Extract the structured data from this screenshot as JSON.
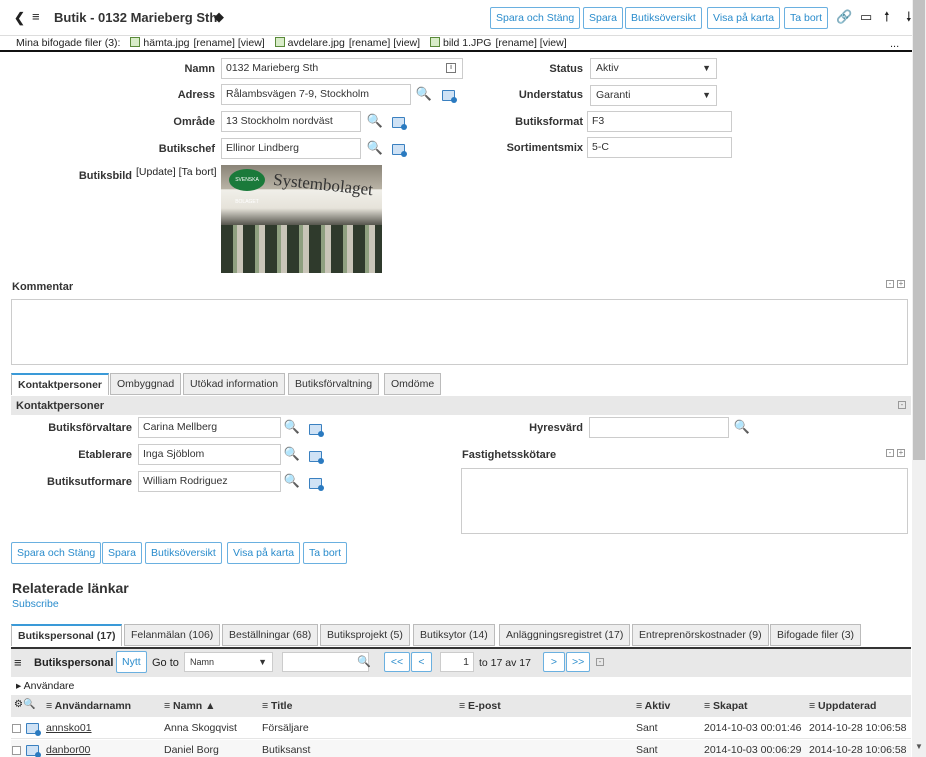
{
  "header": {
    "title": "Butik - 0132 Marieberg Sth",
    "buttons": [
      "Spara och Stäng",
      "Spara",
      "Butiksöversikt",
      "Visa på karta",
      "Ta bort"
    ]
  },
  "files": {
    "label": "Mina bifogade filer (3):",
    "items": [
      {
        "name": "hämta.jpg",
        "actions": "[rename] [view]"
      },
      {
        "name": "avdelare.jpg",
        "actions": "[rename] [view]"
      },
      {
        "name": "bild 1.JPG",
        "actions": "[rename] [view]"
      }
    ],
    "more": "..."
  },
  "form": {
    "namn_label": "Namn",
    "namn": "0132 Marieberg Sth",
    "adress_label": "Adress",
    "adress": "Rålambsvägen 7-9, Stockholm",
    "omrade_label": "Område",
    "omrade": "13 Stockholm nordväst",
    "butikschef_label": "Butikschef",
    "butikschef": "Ellinor Lindberg",
    "butiksbild_label": "Butiksbild",
    "butiksbild_actions": "[Update] [Ta bort]",
    "image_text": "Systembolaget",
    "image_badge": "SVENSKA BOLAGET",
    "status_label": "Status",
    "status": "Aktiv",
    "understatus_label": "Understatus",
    "understatus": "Garanti",
    "butiksformat_label": "Butiksformat",
    "butiksformat": "F3",
    "sortimentsmix_label": "Sortimentsmix",
    "sortimentsmix": "5-C",
    "kommentar_label": "Kommentar"
  },
  "tabs1": [
    "Kontaktpersoner",
    "Ombyggnad",
    "Utökad information",
    "Butiksförvaltning",
    "Omdöme"
  ],
  "contacts": {
    "section": "Kontaktpersoner",
    "forvaltare_label": "Butiksförvaltare",
    "forvaltare": "Carina Mellberg",
    "etablerare_label": "Etablerare",
    "etablerare": "Inga Sjöblom",
    "utformare_label": "Butiksutformare",
    "utformare": "William Rodriguez",
    "hyresvard_label": "Hyresvärd",
    "hyresvard": "",
    "fastighet_label": "Fastighetsskötare"
  },
  "bottom_buttons": [
    "Spara och Stäng",
    "Spara",
    "Butiksöversikt",
    "Visa på karta",
    "Ta bort"
  ],
  "related": {
    "title": "Relaterade länkar",
    "subscribe": "Subscribe"
  },
  "tabs2": [
    "Butikspersonal (17)",
    "Felanmälan (106)",
    "Beställningar (68)",
    "Butiksprojekt (5)",
    "Butiksytor (14)",
    "Anläggningsregistret (17)",
    "Entreprenörskostnader (9)",
    "Bifogade filer (3)"
  ],
  "grid": {
    "title": "Butikspersonal",
    "new": "Nytt",
    "goto": "Go to",
    "goto_field": "Namn",
    "search": "",
    "page": "1",
    "of_text": "to 17 av 17",
    "first": "<<",
    "prev": "<",
    "next": ">",
    "last": ">>",
    "group": "Användare",
    "columns": [
      "Användarnamn",
      "Namn ▲",
      "Title",
      "E-post",
      "Aktiv",
      "Skapat",
      "Uppdaterad"
    ],
    "rows": [
      {
        "user": "annsko01",
        "name": "Anna Skogqvist",
        "title": "Försäljare",
        "email": "",
        "aktiv": "Sant",
        "skapat": "2014-10-03 00:01:46",
        "uppd": "2014-10-28 10:06:58"
      },
      {
        "user": "danbor00",
        "name": "Daniel Borg",
        "title": "Butiksanst",
        "email": "",
        "aktiv": "Sant",
        "skapat": "2014-10-03 00:06:29",
        "uppd": "2014-10-28 10:06:58"
      }
    ]
  }
}
